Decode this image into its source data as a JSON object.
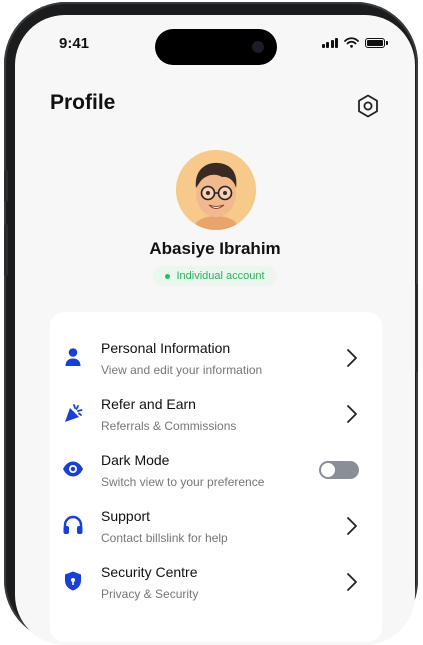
{
  "status_bar": {
    "time": "9:41"
  },
  "header": {
    "title": "Profile",
    "settings_icon": "settings-hexagon-icon"
  },
  "profile": {
    "name": "Abasiye Ibrahim",
    "account_type": "Individual account",
    "badge_color": "#22c15e",
    "avatar_icon": "memoji-avatar"
  },
  "menu": {
    "accent_color": "#1a3fd6",
    "items": [
      {
        "title": "Personal Information",
        "subtitle": "View and edit your information",
        "icon": "user-icon",
        "action": "chevron"
      },
      {
        "title": "Refer and Earn",
        "subtitle": "Referrals & Commissions",
        "icon": "refer-icon",
        "action": "chevron"
      },
      {
        "title": "Dark Mode",
        "subtitle": "Switch view to your preference",
        "icon": "eye-icon",
        "action": "toggle",
        "toggle_on": false
      },
      {
        "title": "Support",
        "subtitle": "Contact billslink for help",
        "icon": "headphones-icon",
        "action": "chevron"
      },
      {
        "title": "Security Centre",
        "subtitle": "Privacy & Security",
        "icon": "shield-icon",
        "action": "chevron"
      }
    ]
  }
}
